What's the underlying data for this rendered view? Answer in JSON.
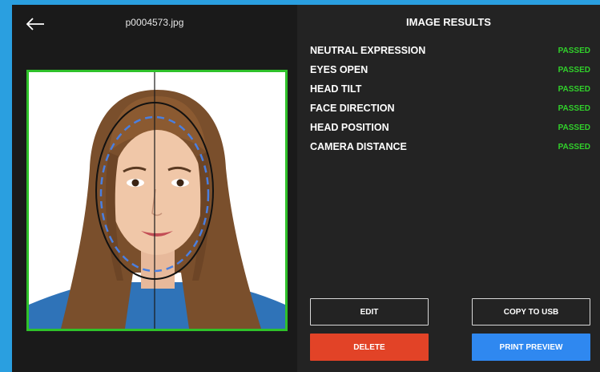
{
  "header": {
    "filename": "p0004573.jpg",
    "back_icon": "arrow-left-icon"
  },
  "results": {
    "title": "IMAGE RESULTS",
    "items": [
      {
        "label": "NEUTRAL EXPRESSION",
        "status": "PASSED"
      },
      {
        "label": "EYES OPEN",
        "status": "PASSED"
      },
      {
        "label": "HEAD TILT",
        "status": "PASSED"
      },
      {
        "label": "FACE DIRECTION",
        "status": "PASSED"
      },
      {
        "label": "HEAD POSITION",
        "status": "PASSED"
      },
      {
        "label": "CAMERA DISTANCE",
        "status": "PASSED"
      }
    ]
  },
  "actions": {
    "edit": "EDIT",
    "copy_to_usb": "COPY TO USB",
    "delete": "DELETE",
    "print_preview": "PRINT PREVIEW"
  },
  "colors": {
    "passed": "#31d02b",
    "photo_border": "#2fc12a",
    "delete": "#e24327",
    "print_preview": "#2f88f0",
    "outer_frame": "#2a9fe0"
  }
}
